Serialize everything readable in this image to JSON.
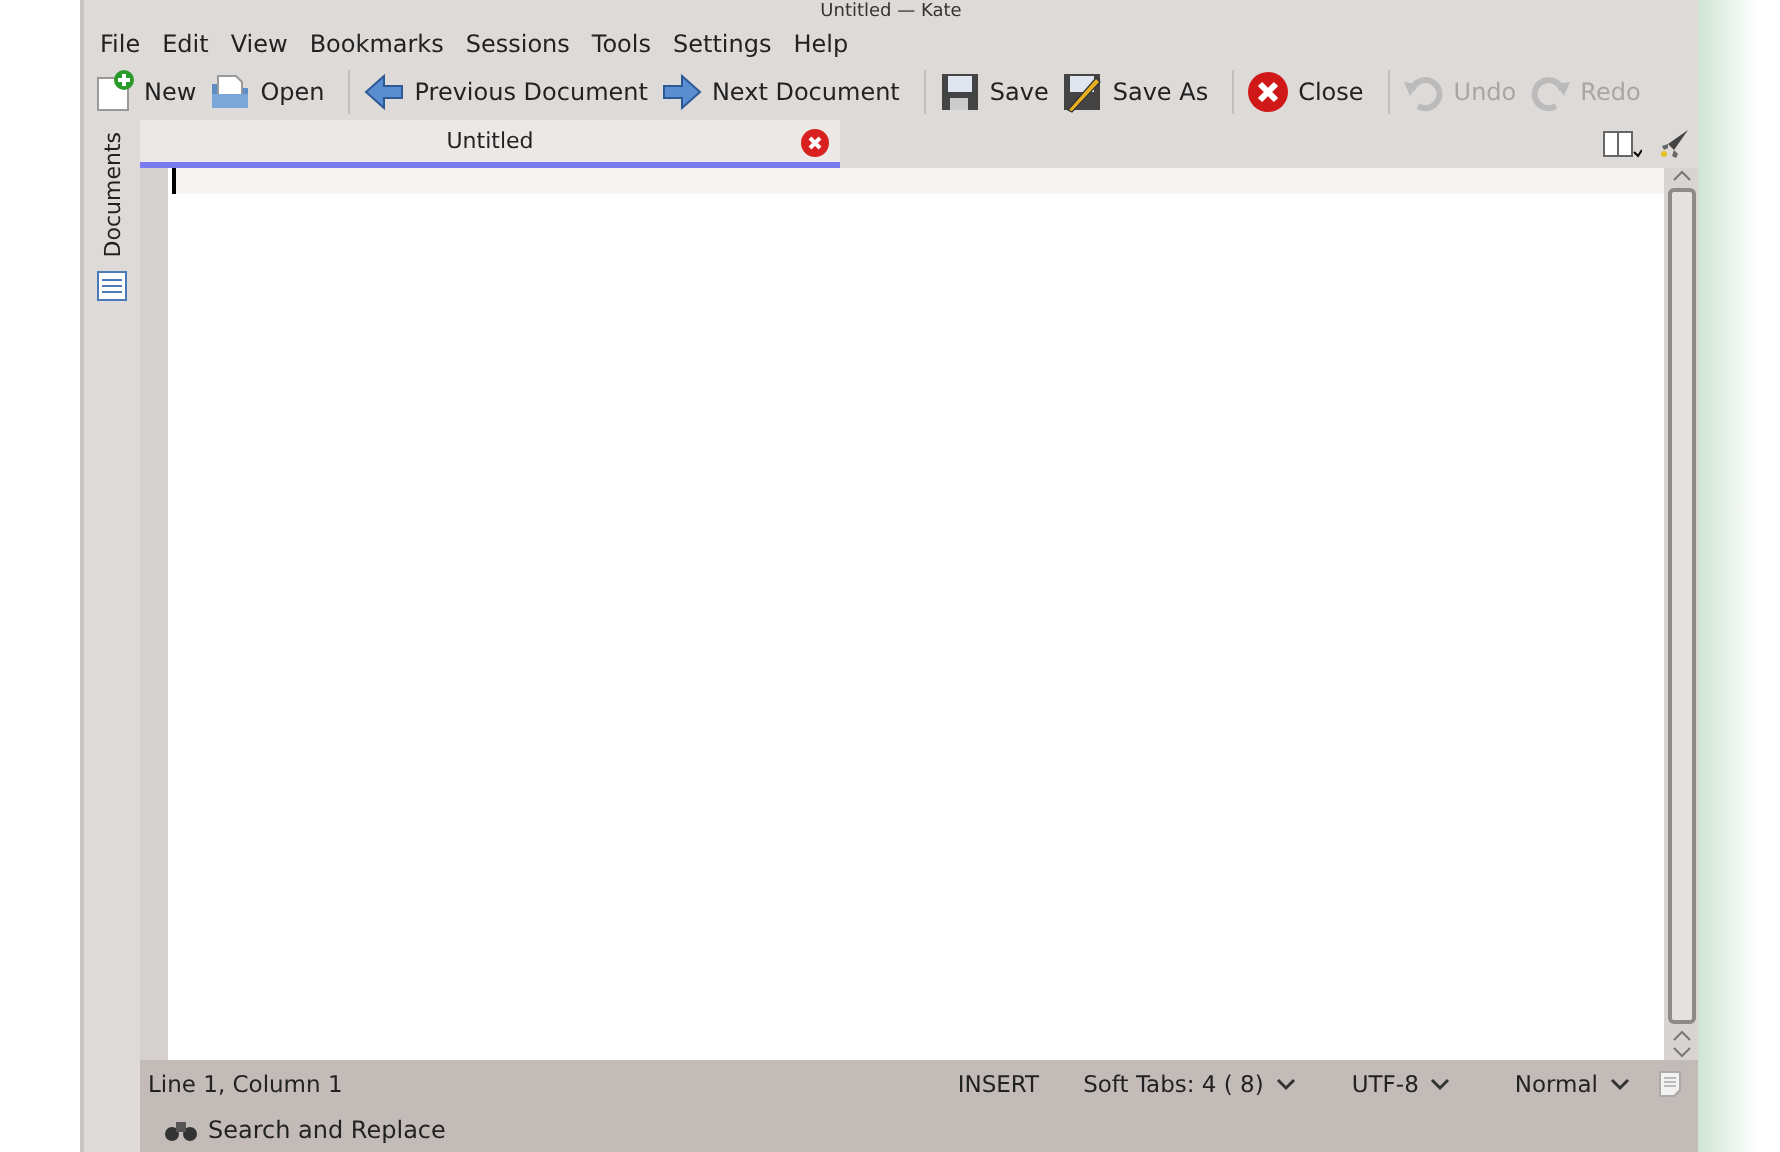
{
  "window": {
    "title": "Untitled  — Kate"
  },
  "menu": [
    "File",
    "Edit",
    "View",
    "Bookmarks",
    "Sessions",
    "Tools",
    "Settings",
    "Help"
  ],
  "toolbar": [
    [
      {
        "label": "New",
        "kind": "new",
        "disabled": false
      },
      {
        "label": "Open",
        "kind": "open",
        "disabled": false
      }
    ],
    [
      {
        "label": "Previous Document",
        "kind": "prev",
        "disabled": false
      },
      {
        "label": "Next Document",
        "kind": "next",
        "disabled": false
      }
    ],
    [
      {
        "label": "Save",
        "kind": "save",
        "disabled": false
      },
      {
        "label": "Save As",
        "kind": "saveas",
        "disabled": false
      }
    ],
    [
      {
        "label": "Close",
        "kind": "close",
        "disabled": false
      }
    ],
    [
      {
        "label": "Undo",
        "kind": "undo",
        "disabled": true
      },
      {
        "label": "Redo",
        "kind": "redo",
        "disabled": true
      }
    ]
  ],
  "sidebar": {
    "tabs": [
      {
        "label": "Documents",
        "selected": false
      }
    ]
  },
  "tabs": [
    {
      "label": "Untitled",
      "selected": true
    }
  ],
  "status_bar": {
    "position": "Line 1, Column 1",
    "mode": "INSERT",
    "indent": "Soft Tabs:  4 ( 8)",
    "encoding": "UTF-8",
    "highlight": "Normal"
  },
  "bottom_bar": {
    "label": "Search and Replace"
  }
}
